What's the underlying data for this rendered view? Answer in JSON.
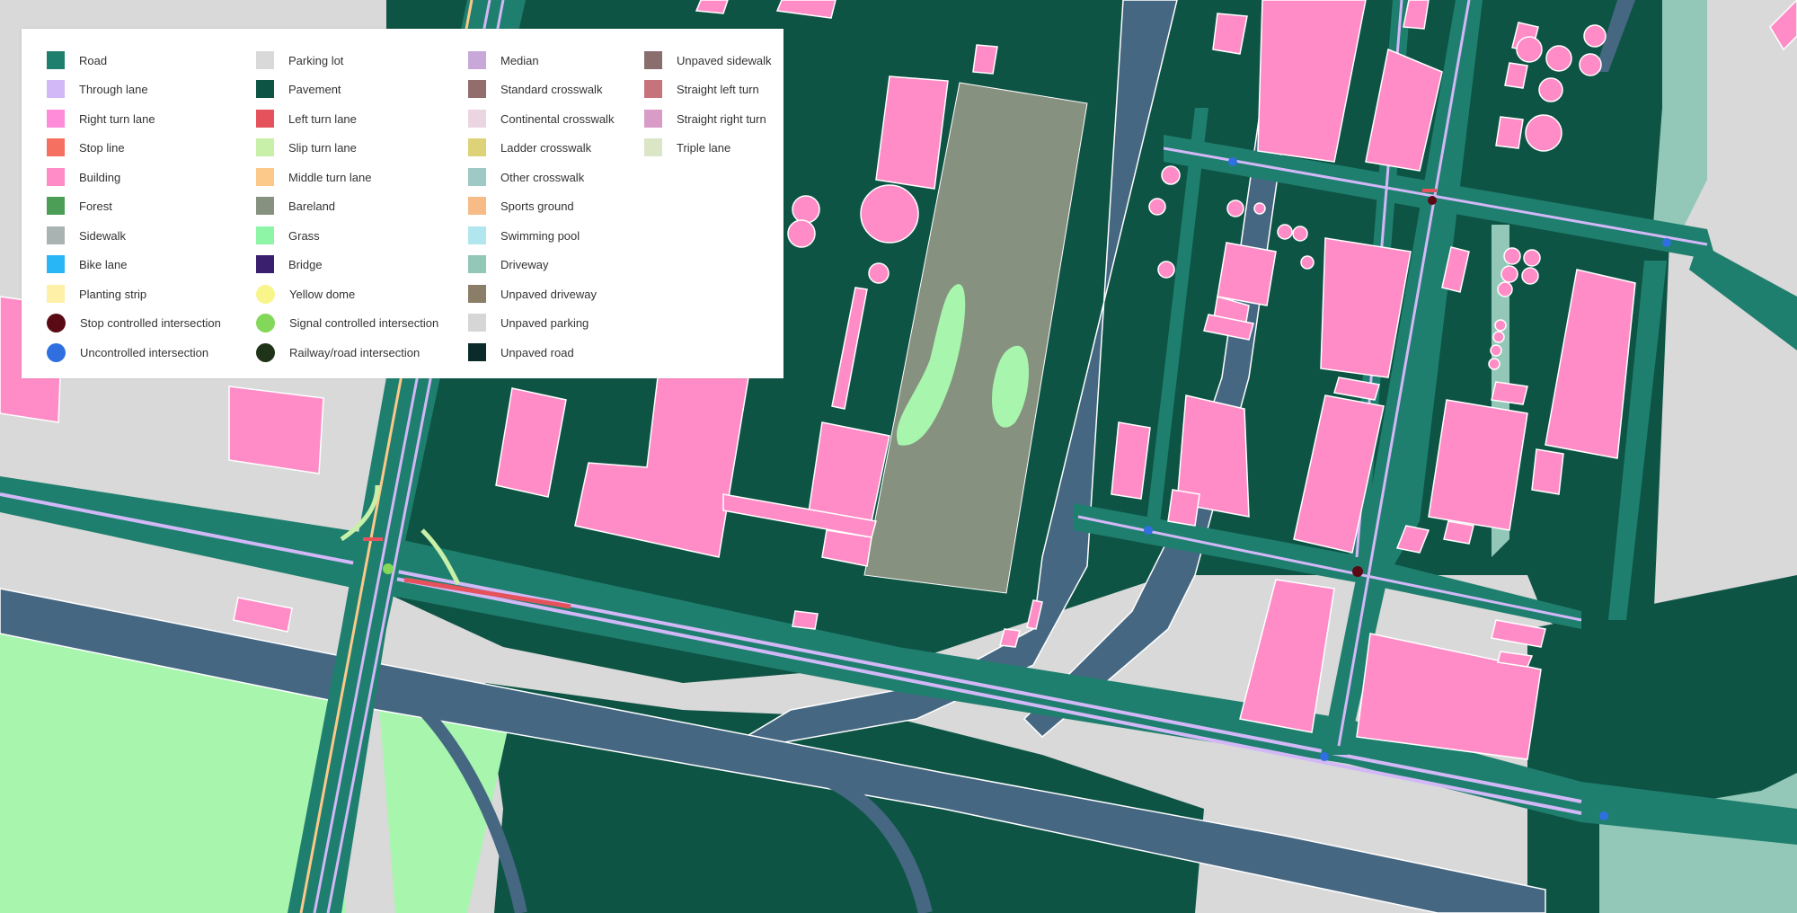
{
  "legend": {
    "columns": [
      [
        {
          "label": "Road",
          "color": "#1f7f6e",
          "shape": "square"
        },
        {
          "label": "Through lane",
          "color": "#d2b8f7",
          "shape": "square"
        },
        {
          "label": "Right turn lane",
          "color": "#ff8cd9",
          "shape": "square"
        },
        {
          "label": "Stop line",
          "color": "#f57060",
          "shape": "square"
        },
        {
          "label": "Building",
          "color": "#ff8cc6",
          "shape": "square"
        },
        {
          "label": "Forest",
          "color": "#4c9e56",
          "shape": "square"
        },
        {
          "label": "Sidewalk",
          "color": "#a9b4b2",
          "shape": "square"
        },
        {
          "label": "Bike lane",
          "color": "#29b6f6",
          "shape": "square"
        },
        {
          "label": "Planting strip",
          "color": "#fff0a8",
          "shape": "square"
        },
        {
          "label": "Stop controlled intersection",
          "color": "#5a0a14",
          "shape": "circle"
        },
        {
          "label": "Uncontrolled intersection",
          "color": "#2f6fe0",
          "shape": "circle"
        }
      ],
      [
        {
          "label": "Parking lot",
          "color": "#d9d9d9",
          "shape": "square"
        },
        {
          "label": "Pavement",
          "color": "#0e5445",
          "shape": "square"
        },
        {
          "label": "Left turn lane",
          "color": "#e5525c",
          "shape": "square"
        },
        {
          "label": "Slip turn lane",
          "color": "#c8f0a8",
          "shape": "square"
        },
        {
          "label": "Middle turn lane",
          "color": "#fcc98a",
          "shape": "square"
        },
        {
          "label": "Bareland",
          "color": "#86917f",
          "shape": "square"
        },
        {
          "label": "Grass",
          "color": "#8ef5a6",
          "shape": "square"
        },
        {
          "label": "Bridge",
          "color": "#3a1f6e",
          "shape": "square"
        },
        {
          "label": "Yellow dome",
          "color": "#f8f58a",
          "shape": "circle"
        },
        {
          "label": "Signal controlled intersection",
          "color": "#83d85a",
          "shape": "circle"
        },
        {
          "label": "Railway/road intersection",
          "color": "#1f3319",
          "shape": "circle"
        }
      ],
      [
        {
          "label": "Median",
          "color": "#c8a8d8",
          "shape": "square"
        },
        {
          "label": "Standard crosswalk",
          "color": "#936c6c",
          "shape": "square"
        },
        {
          "label": "Continental crosswalk",
          "color": "#ecd5e2",
          "shape": "square"
        },
        {
          "label": "Ladder crosswalk",
          "color": "#ded278",
          "shape": "square"
        },
        {
          "label": "Other crosswalk",
          "color": "#9ec9c4",
          "shape": "square"
        },
        {
          "label": "Sports ground",
          "color": "#f6bb86",
          "shape": "square"
        },
        {
          "label": "Swimming pool",
          "color": "#b2e6ef",
          "shape": "square"
        },
        {
          "label": "Driveway",
          "color": "#93c8b8",
          "shape": "square"
        },
        {
          "label": "Unpaved driveway",
          "color": "#8b7e68",
          "shape": "square"
        },
        {
          "label": "Unpaved parking",
          "color": "#d6d6d6",
          "shape": "square"
        },
        {
          "label": "Unpaved road",
          "color": "#0b2b2a",
          "shape": "square"
        }
      ],
      [
        {
          "label": "Unpaved sidewalk",
          "color": "#8a6e6e",
          "shape": "square"
        },
        {
          "label": "Straight left turn",
          "color": "#c6737c",
          "shape": "square"
        },
        {
          "label": "Straight right turn",
          "color": "#d99cc6",
          "shape": "square"
        },
        {
          "label": "Triple lane",
          "color": "#dbe6c6",
          "shape": "square"
        }
      ]
    ]
  },
  "colors": {
    "background": "#d9d9d9",
    "pavement": "#0e5445",
    "road": "#1f7f6e",
    "bridge_road": "#456782",
    "through_lane": "#d2b8f7",
    "building": "#ff8cc6",
    "grass": "#a8f5ae",
    "bareland": "#86917f",
    "driveway": "#93c8b8",
    "stop_line": "#e5525c",
    "slip_lane": "#c8f0a8",
    "middle_turn": "#fcc98a"
  }
}
